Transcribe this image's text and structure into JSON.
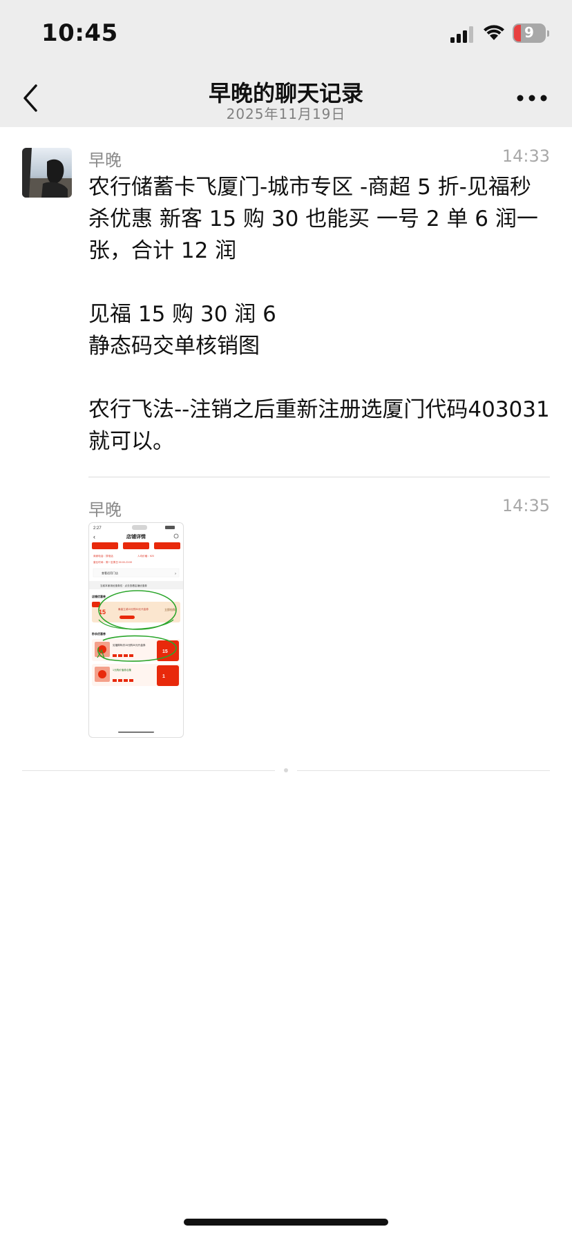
{
  "status_bar": {
    "time": "10:45",
    "battery": "9",
    "icons": [
      "cellular-signal-icon",
      "wifi-icon",
      "battery-charging-icon"
    ]
  },
  "nav": {
    "title": "早晚的聊天记录",
    "subtitle": "2025年11月19日",
    "back_icon": "chevron-left-icon",
    "more_icon": "more-dots-icon"
  },
  "messages": [
    {
      "sender": "早晚",
      "time": "14:33",
      "paragraphs": [
        "农行储蓄卡飞厦门-城市专区 -商超 5 折-见福秒杀优惠 新客 15 购 30 也能买 一号 2 单 6 润一张，合计 12 润",
        "见福 15 购 30 润 6",
        "静态码交单核销图",
        "农行飞法--注销之后重新注册选厦门代码403031就可以。"
      ]
    },
    {
      "sender": "早晚",
      "time": "14:35",
      "attachment": "image",
      "thumbnail": {
        "time": "2:27",
        "header": "店铺详情",
        "rows": [
          "商家电话：拨电话",
          "人均价格：¥20",
          "营业时间：周一至周日 00:00-23:59"
        ],
        "view_stores": "查看适用门店",
        "notice": "当前本家用优惠券仅 · 点去查看店铺优惠券",
        "section1": "店铺优惠券",
        "coupon_main": "15",
        "coupon_desc": "最高立减15元购30元代金券",
        "coupon_btn": "立即抢购",
        "section2": "秒杀优惠券",
        "deal1_title": "见福周年庆15元购30元代金券",
        "deal1_price": "15",
        "deal2_title": "1元购价值券合集",
        "deal2_price": "1"
      }
    }
  ],
  "colors": {
    "bar_bg": "#ededed",
    "text_main": "#111111",
    "text_meta": "#8a8a8a",
    "accent_red": "#e8290b",
    "annotation_green": "#2aa52a"
  }
}
